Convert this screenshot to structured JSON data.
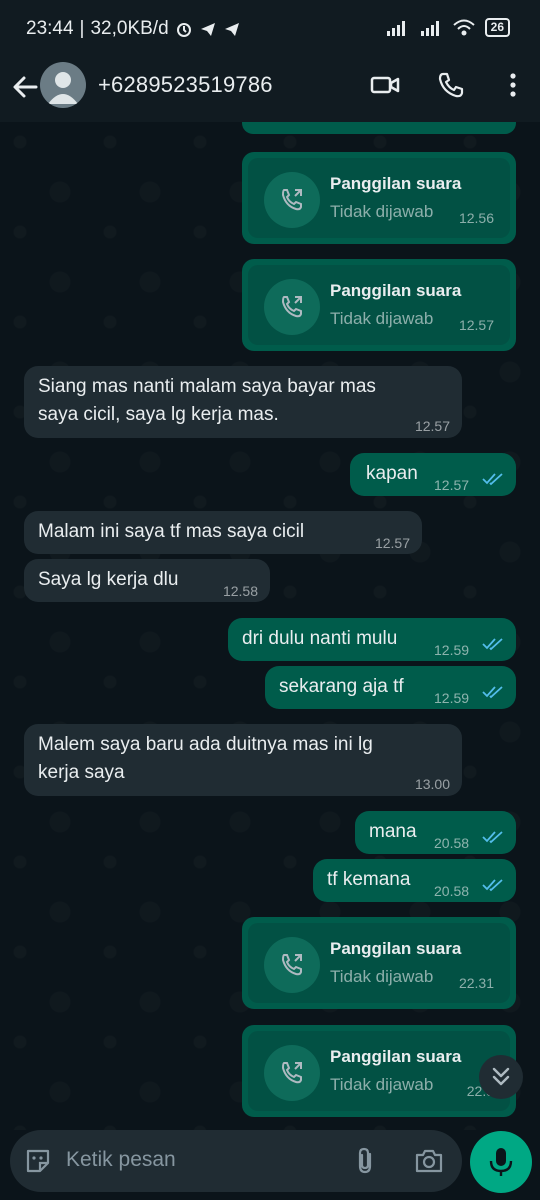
{
  "status_bar": {
    "time": "23:44",
    "speed": "32,0KB/d",
    "battery": "26"
  },
  "header": {
    "contact": "+6289523519786",
    "icons": [
      "back-arrow-icon",
      "avatar",
      "video-call-icon",
      "voice-call-icon",
      "more-vert-icon"
    ]
  },
  "messages": [
    {
      "type": "call",
      "dir": "out",
      "title": "Panggilan suara",
      "status": "Tidak dijawab",
      "time": "12.56"
    },
    {
      "type": "call",
      "dir": "out",
      "title": "Panggilan suara",
      "status": "Tidak dijawab",
      "time": "12.57"
    },
    {
      "type": "text",
      "dir": "in",
      "lines": [
        "Siang mas nanti malam saya bayar mas",
        "saya cicil, saya lg kerja mas."
      ],
      "time": "12.57"
    },
    {
      "type": "text",
      "dir": "out",
      "text": "kapan",
      "time": "12.57",
      "read": true
    },
    {
      "type": "text",
      "dir": "in",
      "text": "Malam ini saya tf mas saya cicil",
      "time": "12.57"
    },
    {
      "type": "text",
      "dir": "in",
      "text": "Saya lg kerja dlu",
      "time": "12.58"
    },
    {
      "type": "text",
      "dir": "out",
      "text": "dri dulu nanti mulu",
      "time": "12.59",
      "read": true
    },
    {
      "type": "text",
      "dir": "out",
      "text": "sekarang aja tf",
      "time": "12.59",
      "read": true
    },
    {
      "type": "text",
      "dir": "in",
      "lines": [
        "Malem saya baru ada duitnya mas ini lg",
        "kerja saya"
      ],
      "time": "13.00"
    },
    {
      "type": "text",
      "dir": "out",
      "text": "mana",
      "time": "20.58",
      "read": true
    },
    {
      "type": "text",
      "dir": "out",
      "text": "tf kemana",
      "time": "20.58",
      "read": true
    },
    {
      "type": "call",
      "dir": "out",
      "title": "Panggilan suara",
      "status": "Tidak dijawab",
      "time": "22.31"
    },
    {
      "type": "call",
      "dir": "out",
      "title": "Panggilan suara",
      "status": "Tidak dijawab",
      "time": "22.3"
    }
  ],
  "input": {
    "placeholder": "Ketik pesan"
  },
  "colors": {
    "background": "#0b141a",
    "incoming": "#202c33",
    "outgoing": "#005c4b",
    "accent": "#00a884",
    "read_ticks": "#53bdeb"
  }
}
